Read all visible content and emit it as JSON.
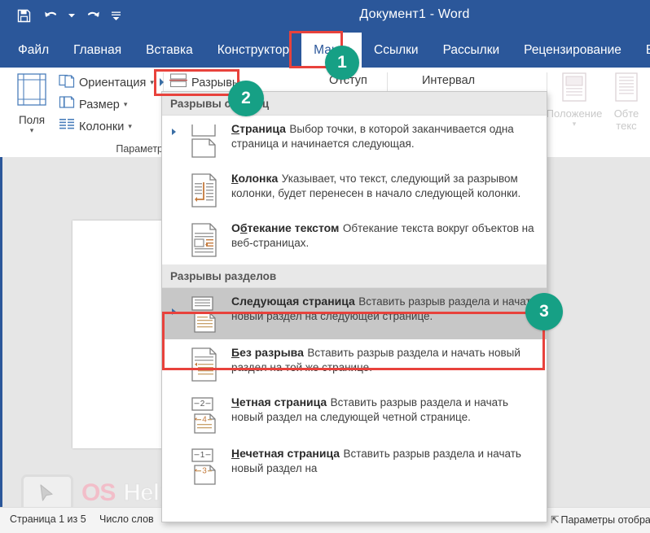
{
  "titlebar": {
    "document_title": "Документ1  -  Word",
    "quick_access": [
      {
        "name": "save-icon",
        "label": "Сохранить"
      },
      {
        "name": "undo-icon",
        "label": "Отменить"
      },
      {
        "name": "redo-icon",
        "label": "Вернуть"
      },
      {
        "name": "customize-qat-icon",
        "label": "Настройка панели быстрого доступа"
      }
    ]
  },
  "tabs": [
    {
      "label": "Файл",
      "active": false
    },
    {
      "label": "Главная",
      "active": false
    },
    {
      "label": "Вставка",
      "active": false
    },
    {
      "label": "Конструктор",
      "active": false
    },
    {
      "label": "Макет",
      "active": true
    },
    {
      "label": "Ссылки",
      "active": false
    },
    {
      "label": "Рассылки",
      "active": false
    },
    {
      "label": "Рецензирование",
      "active": false
    },
    {
      "label": "Вид",
      "active": false
    }
  ],
  "ribbon": {
    "page_setup": {
      "group_label": "Параметр",
      "margins_button": "Поля",
      "orientation_button": "Ориентация",
      "size_button": "Размер",
      "columns_button": "Колонки",
      "breaks_button": "Разрывы"
    },
    "paragraph": {
      "indent_header": "Отступ",
      "spacing_header": "Интервал"
    },
    "arrange": {
      "position_button": "Положение",
      "wrap_text_button": "Обте\nтекс"
    }
  },
  "menu": {
    "sections": [
      {
        "header": "Разрывы страниц",
        "items": [
          {
            "title": "Страница",
            "accel": "С",
            "description": "Выбор точки, в которой заканчивается одна страница и начинается следующая.",
            "icon": "page-break-icon",
            "selected": false,
            "has_marker": true
          },
          {
            "title": "Колонка",
            "accel": "К",
            "description": "Указывает, что текст, следующий за разрывом колонки, будет перенесен в начало следующей колонки.",
            "icon": "column-break-icon",
            "selected": false,
            "has_marker": false
          },
          {
            "title": "Обтекание текстом",
            "accel": "б",
            "description": "Обтекание текста вокруг объектов на веб-страницах.",
            "icon": "text-wrapping-break-icon",
            "selected": false,
            "has_marker": false
          }
        ]
      },
      {
        "header": "Разрывы разделов",
        "items": [
          {
            "title": "Следующая страница",
            "accel": "",
            "description": "Вставить разрыв раздела и начать новый раздел на следующей странице.",
            "icon": "next-page-section-icon",
            "selected": true,
            "has_marker": true
          },
          {
            "title": "Без разрыва",
            "accel": "Б",
            "description": "Вставить разрыв раздела и начать новый раздел на той же странице.",
            "icon": "continuous-section-icon",
            "selected": false,
            "has_marker": false
          },
          {
            "title": "Четная страница",
            "accel": "Ч",
            "description": "Вставить разрыв раздела и начать новый раздел на следующей четной странице.",
            "icon": "even-page-section-icon",
            "selected": false,
            "has_marker": false
          },
          {
            "title": "Нечетная страница",
            "accel": "Н",
            "description": "Вставить разрыв раздела и начать новый раздел на",
            "icon": "odd-page-section-icon",
            "selected": false,
            "has_marker": false
          }
        ]
      }
    ]
  },
  "statusbar": {
    "page_indicator": "Страница 1 из 5",
    "word_count": "Число слов",
    "display_settings": "Параметры отобра"
  },
  "callouts": [
    {
      "number": "1",
      "target": "makety-tab"
    },
    {
      "number": "2",
      "target": "breaks-button"
    },
    {
      "number": "3",
      "target": "next-page-menu-item"
    }
  ],
  "watermark": {
    "os_text": "OS",
    "helper_text": "Helper"
  },
  "colors": {
    "word_blue": "#2b579a",
    "highlight_red": "#e8423c",
    "badge_green": "#16a085",
    "menu_selected": "#c7c7c7"
  }
}
